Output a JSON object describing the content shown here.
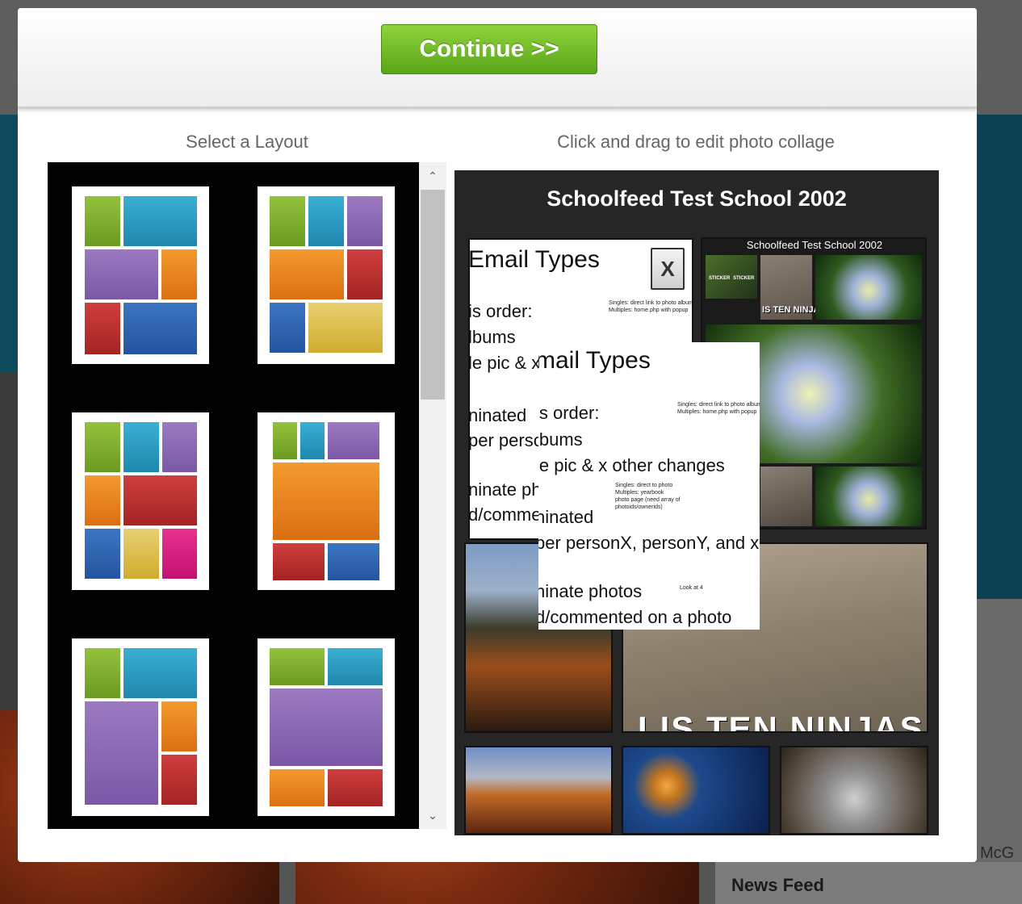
{
  "background": {
    "news_feed_label": "News Feed",
    "partial_name": "McG"
  },
  "modal": {
    "continue_label": "Continue >>",
    "layout_heading": "Select a Layout",
    "collage_heading": "Click and drag to edit photo collage"
  },
  "layouts": [
    {
      "name": "layout-1"
    },
    {
      "name": "layout-2"
    },
    {
      "name": "layout-3"
    },
    {
      "name": "layout-4"
    },
    {
      "name": "layout-5"
    },
    {
      "name": "layout-6"
    }
  ],
  "scrollbar": {
    "up_arrow": "⌃",
    "down_arrow": "⌄"
  },
  "collage": {
    "title": "Schoolfeed Test School 2002",
    "close_label": "X",
    "mini_collage_title": "Schoolfeed Test School 2002",
    "ninja_caption_small": "IS TEN NINJA",
    "ninja_caption_large": "LIS TEN NINJAS",
    "doc_back": {
      "heading": "Email Types",
      "lines": [
        "is order:",
        "lbums",
        "le pic & x",
        "ninated",
        "per perso",
        "ninate ph",
        "d/comme"
      ],
      "notes": [
        "Singles: direct link to photo album",
        "Multiples: home.php with popup"
      ]
    },
    "doc_front": {
      "heading": "mail Types",
      "lines": [
        "is order:",
        "lbums",
        "le pic & x other changes",
        "ninated",
        "per personX, personY, and x",
        "ninate photos",
        "d/commented on a photo"
      ],
      "notes_a": [
        "Singles: direct link to photo album",
        "Multiples: home.php with popup"
      ],
      "notes_b": [
        "Singles: direct to photo",
        "Multiples: yearbook",
        "photo page (need array of",
        "photoids/ownerids)"
      ],
      "note_c": "Look at 4"
    }
  },
  "colors": {
    "continue_green": "#6bb524",
    "collage_bg": "#262626",
    "layout_bg": "#000000"
  }
}
